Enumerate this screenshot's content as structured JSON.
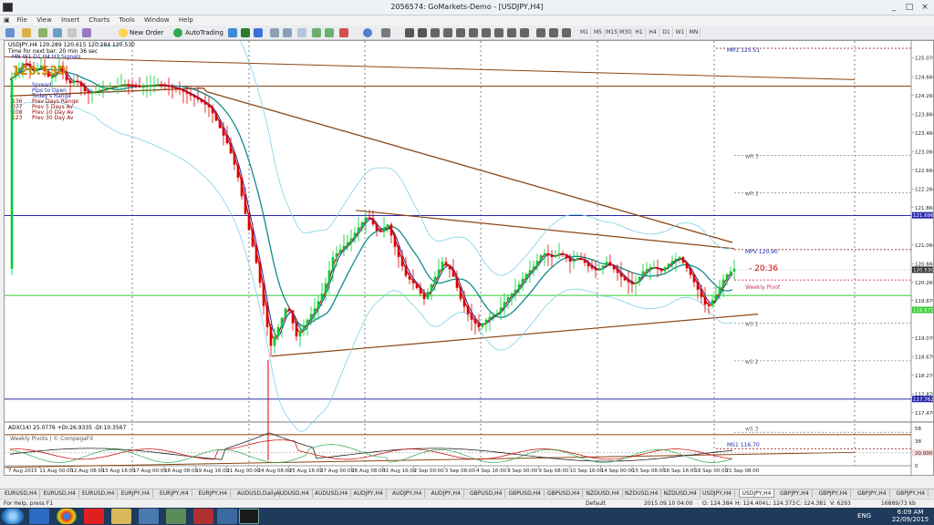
{
  "window": {
    "title": "2056574: GoMarkets-Demo - [USDJPY,H4]",
    "controls": [
      "_",
      "□",
      "×"
    ]
  },
  "menu": [
    "File",
    "View",
    "Insert",
    "Charts",
    "Tools",
    "Window",
    "Help"
  ],
  "toolbar": {
    "new_order": "New Order",
    "auto_trading": "AutoTrading",
    "timeframes": [
      "M1",
      "M5",
      "M15",
      "M30",
      "H1",
      "H4",
      "D1",
      "W1",
      "MN"
    ]
  },
  "chart": {
    "header": "USDJPY,H4  120.289 120.615 120.284 120.530",
    "timer_line": "Time for next bar: 20 min 36 sec",
    "mini_tf": "MN  W1  D1  H4  H1  Signals",
    "big_price": "120.530",
    "info_rows": [
      {
        "value": "",
        "label": "Spread"
      },
      {
        "value": "",
        "label": "Pips to Open"
      },
      {
        "value": "",
        "label": "Today's Range"
      },
      {
        "value": "136",
        "label": "Prev Days Range"
      },
      {
        "value": "077",
        "label": "Prev 5 Days Av"
      },
      {
        "value": "108",
        "label": "Prev 10 Day Av"
      },
      {
        "value": "123",
        "label": "Prev 30 Day Av"
      }
    ],
    "price_labels": [
      "125.070",
      "124.660",
      "124.260",
      "123.860",
      "123.460",
      "123.060",
      "122.660",
      "122.260",
      "121.860",
      "121.696",
      "121.060",
      "120.660",
      "120.530",
      "120.260",
      "119.870",
      "119.670",
      "119.070",
      "118.670",
      "118.270",
      "117.870",
      "117.762",
      "117.470",
      "117.070",
      "116.670",
      "116.270",
      "125.460",
      "117.003"
    ],
    "x_labels": [
      "7 Aug 2015",
      "11 Aug 00:00",
      "12 Aug 08:00",
      "13 Aug 16:00",
      "17 Aug 00:00",
      "18 Aug 08:00",
      "19 Aug 16:00",
      "21 Aug 00:00",
      "24 Aug 08:00",
      "25 Aug 16:00",
      "27 Aug 00:00",
      "28 Aug 08:00",
      "31 Aug 16:00",
      "2 Sep 00:00",
      "3 Sep 08:00",
      "4 Sep 16:00",
      "8 Sep 00:00",
      "9 Sep 08:00",
      "10 Sep 16:00",
      "14 Sep 00:00",
      "15 Sep 08:00",
      "16 Sep 16:00",
      "18 Sep 00:00",
      "21 Sep 08:00"
    ],
    "pivots": [
      {
        "label": "MR1   125.51"
      },
      {
        "label": "wR 3"
      },
      {
        "label": "wR 2"
      },
      {
        "label": "MPV   120.90"
      },
      {
        "label": "Weekly Pivot"
      },
      {
        "label": "wS 1"
      },
      {
        "label": "wS 2"
      },
      {
        "label": "wS 3"
      },
      {
        "label": "MS1   116.70"
      }
    ],
    "countdown": "- 20:36",
    "watermark": "Weekly Pivots | © CompegaFX",
    "adx_header": "ADX(14) 25.0776 +DI:26.9335 -DI:10.3567",
    "adx_scale": [
      "58",
      "38",
      "20.000",
      "0"
    ]
  },
  "tabs": [
    "EURUSD,H4",
    "EURUSD,H4",
    "EURUSD,H4",
    "EURJPY,H4",
    "EURJPY,H4",
    "EURJPY,H4",
    "AUDUSD,Daily",
    "AUDUSD,H4",
    "AUDUSD,H4",
    "AUDJPY,H4",
    "AUDJPY,H4",
    "AUDJPY,H4",
    "GBPUSD,H4",
    "GBPUSD,H4",
    "GBPUSD,H4",
    "NZDUSD,H4",
    "NZDUSD,H4",
    "NZDUSD,H4",
    "USDJPY,H4",
    "USDJPY,H4",
    "GBPJPY,H4",
    "GBPJPY,H4",
    "GBPJPY,H4",
    "GBPJPY,H4"
  ],
  "active_tab_index": 19,
  "status": {
    "help": "For Help, press F1",
    "profile": "Default",
    "datetime": "2015.09.10 04:00",
    "open": "O: 124.384",
    "high": "H: 124.404",
    "low": "L: 124.373",
    "close": "C: 124.381",
    "volume": "V: 6293",
    "traffic": "16889/73 kb"
  },
  "taskbar": {
    "lang": "ENG",
    "time": "6:09 AM",
    "date": "22/09/2015"
  },
  "colors": {
    "candle_up": "#00cc33",
    "candle_down": "#dd0000",
    "trend_brown": "#8b4513",
    "hline_blue": "#2a2aaa",
    "hline_green": "#33cc33",
    "hline_maroon": "#8b0000"
  }
}
